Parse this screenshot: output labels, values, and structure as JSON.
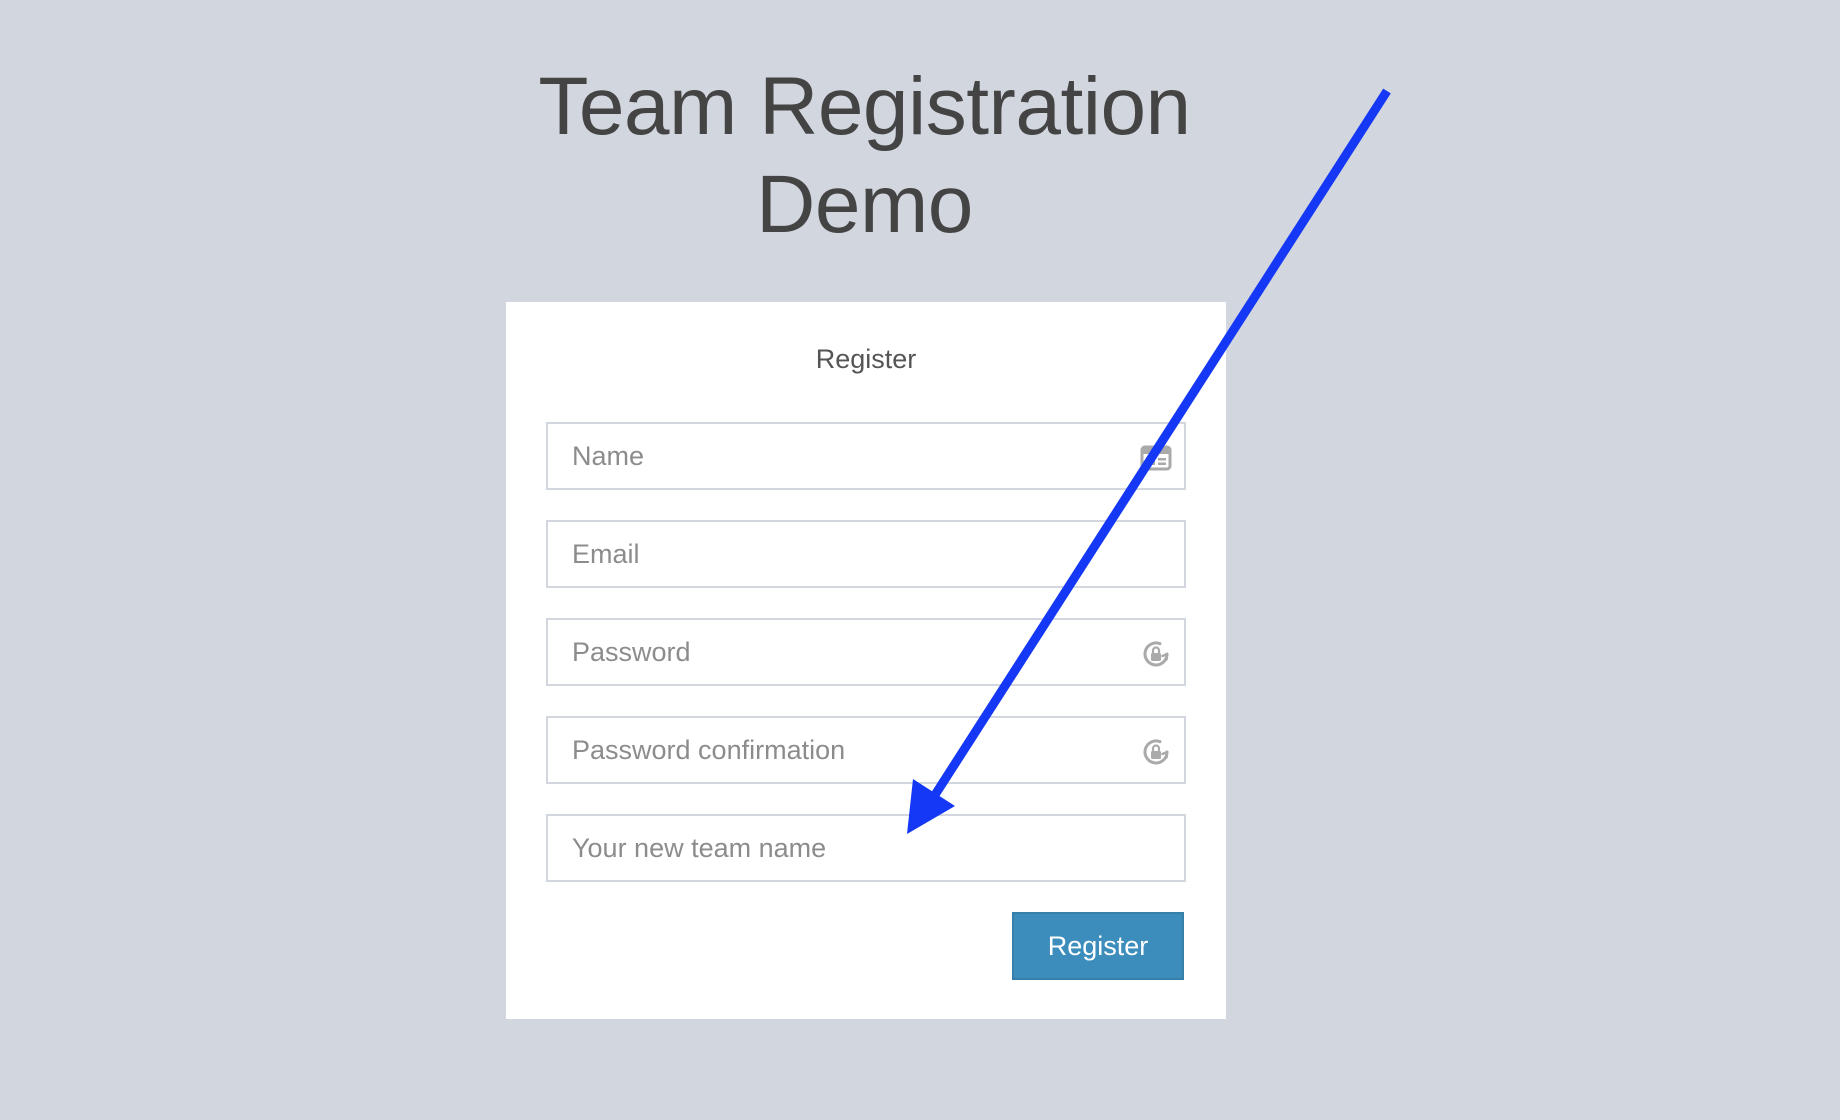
{
  "page": {
    "title_line1": "Team Registration",
    "title_line2": "Demo"
  },
  "form": {
    "heading": "Register",
    "fields": [
      {
        "placeholder": "Name",
        "value": "",
        "icon": "id-card-icon"
      },
      {
        "placeholder": "Email",
        "value": "",
        "icon": null
      },
      {
        "placeholder": "Password",
        "value": "",
        "icon": "lock-refresh-icon"
      },
      {
        "placeholder": "Password confirmation",
        "value": "",
        "icon": "lock-refresh-icon"
      },
      {
        "placeholder": "Your new team name",
        "value": "",
        "icon": null
      }
    ],
    "submit_label": "Register"
  },
  "colors": {
    "background": "#d2d6de",
    "card": "#ffffff",
    "title_text": "#444444",
    "button": "#3c8dbc",
    "annotation_arrow": "#1438f5",
    "icon": "#aaaaaa"
  },
  "annotation": {
    "type": "arrow",
    "points_to": "team-name-field"
  }
}
